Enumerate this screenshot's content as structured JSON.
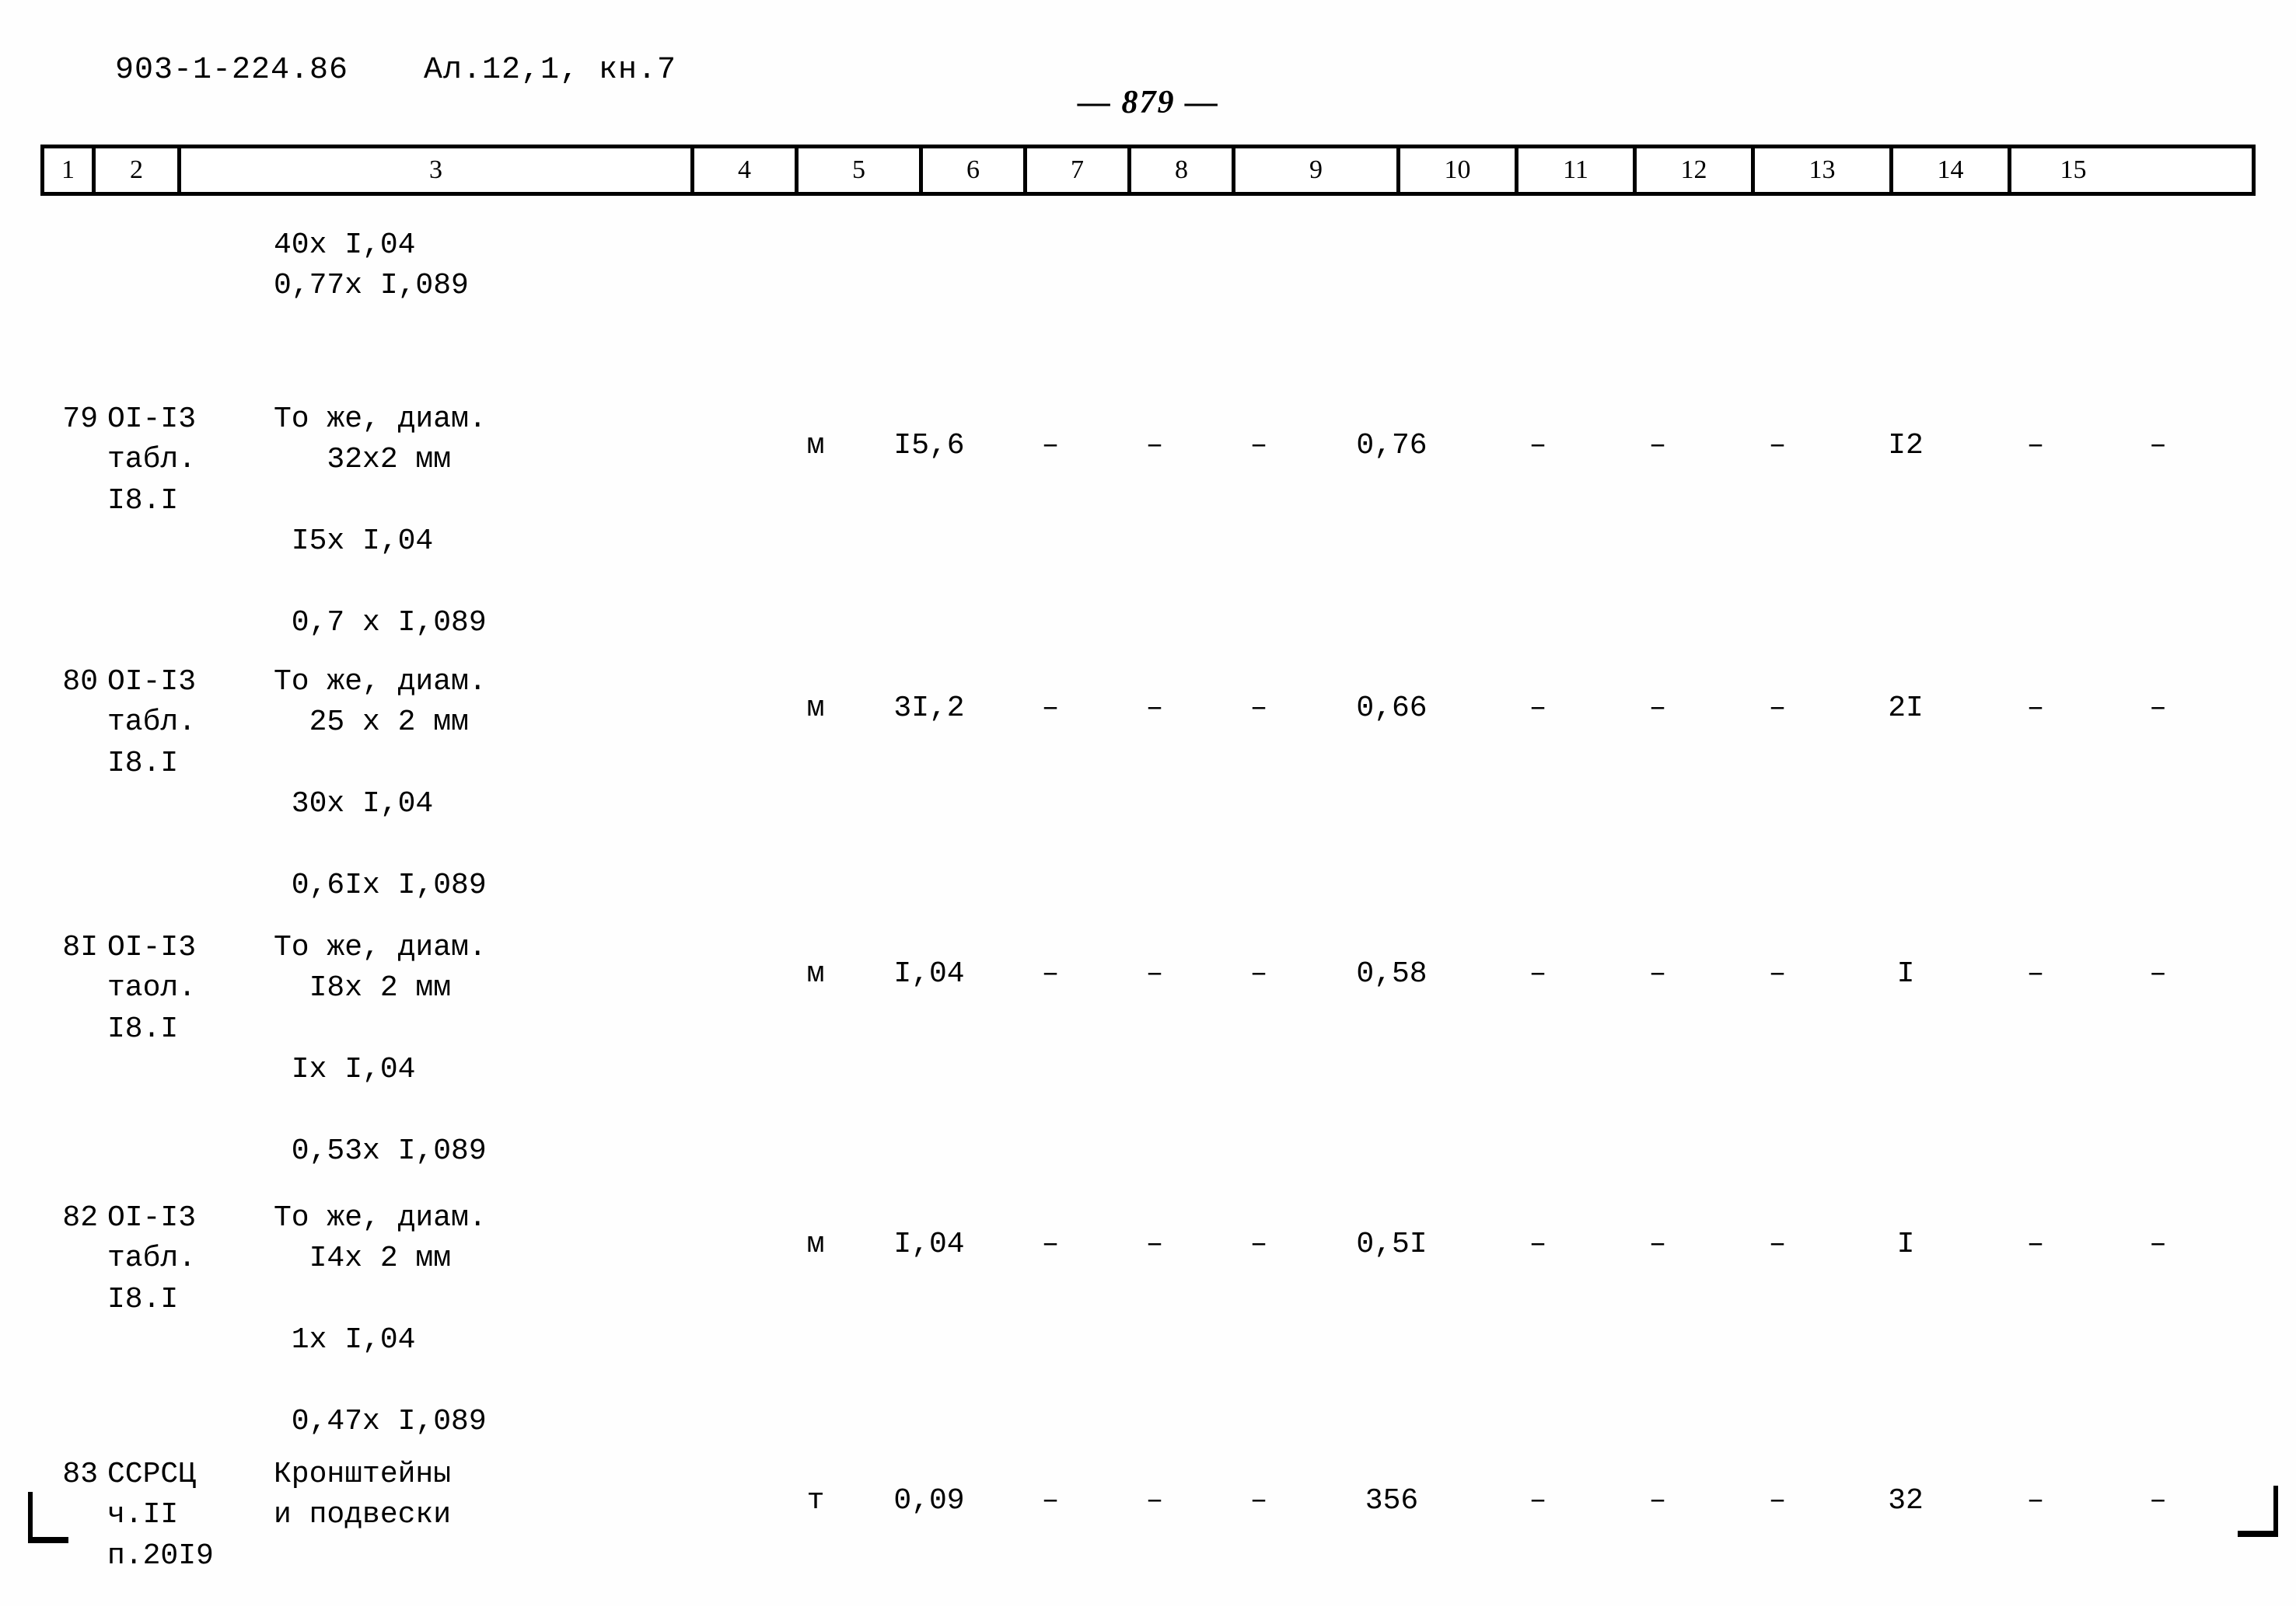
{
  "document": {
    "code": "903-1-224.86",
    "album": "Ал.12,1, кн.7",
    "page_number": "— 879 —"
  },
  "table": {
    "column_headers": [
      "1",
      "2",
      "3",
      "4",
      "5",
      "6",
      "7",
      "8",
      "9",
      "10",
      "11",
      "12",
      "13",
      "14",
      "15"
    ],
    "rows": [
      {
        "pos": "",
        "justification": "",
        "name_lines": [
          "40х I,04",
          "0,77х I,089"
        ],
        "unit": "",
        "c5": "",
        "c6": "",
        "c7": "",
        "c8": "",
        "c9": "",
        "c10": "",
        "c11": "",
        "c12": "",
        "c13": "",
        "c14": "",
        "c15": ""
      },
      {
        "pos": "79",
        "justification": "ОI-I3\nтабл.\nI8.I",
        "name_lines": [
          "То же, диам.",
          "   32х2 мм",
          "",
          " I5х I,04",
          "",
          " 0,7 х I,089"
        ],
        "unit": "м",
        "c5": "I5,6",
        "c6": "–",
        "c7": "–",
        "c8": "–",
        "c9": "0,76",
        "c10": "–",
        "c11": "–",
        "c12": "–",
        "c13": "I2",
        "c14": "–",
        "c15": "–"
      },
      {
        "pos": "80",
        "justification": "ОI-I3\nтабл.\nI8.I",
        "name_lines": [
          "То же, диам.",
          "  25 х 2 мм",
          "",
          " 30х I,04",
          "",
          " 0,6Iх I,089"
        ],
        "unit": "м",
        "c5": "3I,2",
        "c6": "–",
        "c7": "–",
        "c8": "–",
        "c9": "0,66",
        "c10": "–",
        "c11": "–",
        "c12": "–",
        "c13": "2I",
        "c14": "–",
        "c15": "–"
      },
      {
        "pos": "8I",
        "justification": "ОI-I3\nтаол.\nI8.I",
        "name_lines": [
          "То же, диам.",
          "  I8х 2 мм",
          "",
          " Iх I,04",
          "",
          " 0,53х I,089"
        ],
        "unit": "м",
        "c5": "I,04",
        "c6": "–",
        "c7": "–",
        "c8": "–",
        "c9": "0,58",
        "c10": "–",
        "c11": "–",
        "c12": "–",
        "c13": "I",
        "c14": "–",
        "c15": "–"
      },
      {
        "pos": "82",
        "justification": "ОI-I3\nтабл.\nI8.I",
        "name_lines": [
          "То же, диам.",
          "  I4х 2 мм",
          "",
          " 1х I,04",
          "",
          " 0,47х I,089"
        ],
        "unit": "м",
        "c5": "I,04",
        "c6": "–",
        "c7": "–",
        "c8": "–",
        "c9": "0,5I",
        "c10": "–",
        "c11": "–",
        "c12": "–",
        "c13": "I",
        "c14": "–",
        "c15": "–"
      },
      {
        "pos": "83",
        "justification": "ССРСЦ\nч.II\nп.20I9",
        "name_lines": [
          "Кронштейны",
          "и подвески"
        ],
        "unit": "т",
        "c5": "0,09",
        "c6": "–",
        "c7": "–",
        "c8": "–",
        "c9": "356",
        "c10": "–",
        "c11": "–",
        "c12": "–",
        "c13": "32",
        "c14": "–",
        "c15": "–"
      }
    ]
  }
}
